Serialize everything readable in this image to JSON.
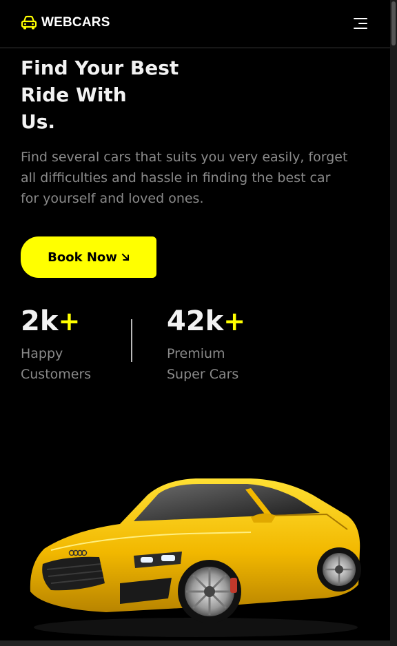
{
  "brand": {
    "name": "WEBCARS",
    "logo_icon": "car-icon",
    "accent_color": "#ffff00"
  },
  "nav": {
    "menu_icon": "hamburger-menu-icon"
  },
  "hero": {
    "title_lines": [
      "Find Your Best",
      "Ride With",
      "Us."
    ],
    "description_lines": [
      "Find several cars that suits you very easily, forget",
      "all difficulties and hassle in finding the best car",
      "for yourself and loved ones."
    ],
    "cta": {
      "label": "Book Now",
      "icon": "arrow-down-right-icon"
    }
  },
  "stats": [
    {
      "value": "2k",
      "suffix": "+",
      "label_lines": [
        "Happy",
        "Customers"
      ]
    },
    {
      "value": "42k",
      "suffix": "+",
      "label_lines": [
        "Premium",
        "Super Cars"
      ]
    }
  ],
  "colors": {
    "background": "#000000",
    "accent": "#ffff00",
    "muted_text": "#8a8a8a",
    "heading_text": "#f2f2f2"
  }
}
